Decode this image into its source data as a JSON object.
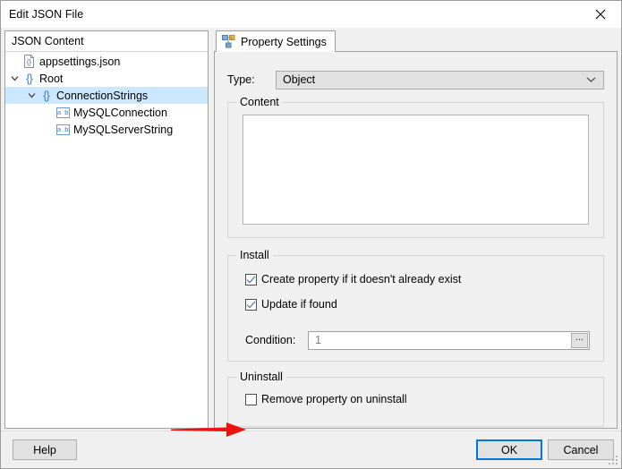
{
  "window": {
    "title": "Edit JSON File",
    "close_icon": "close-icon"
  },
  "tree": {
    "header": "JSON Content",
    "items": [
      {
        "label": "appsettings.json",
        "icon": "json-file-icon",
        "depth": 0,
        "chevron": "none",
        "selected": false
      },
      {
        "label": "Root",
        "icon": "json-object-icon",
        "depth": 0,
        "chevron": "expanded",
        "selected": false
      },
      {
        "label": "ConnectionStrings",
        "icon": "json-object-icon",
        "depth": 1,
        "chevron": "expanded",
        "selected": true
      },
      {
        "label": "MySQLConnection",
        "icon": "json-string-icon",
        "depth": 2,
        "chevron": "none",
        "selected": false
      },
      {
        "label": "MySQLServerString",
        "icon": "json-string-icon",
        "depth": 2,
        "chevron": "none",
        "selected": false
      }
    ],
    "object_glyph": "{}",
    "string_glyph": "a b"
  },
  "tab": {
    "label": "Property Settings",
    "icon": "hierarchy-icon"
  },
  "type": {
    "label": "Type:",
    "value": "Object",
    "dropdown_icon": "chevron-down-icon"
  },
  "content_group": {
    "title": "Content",
    "value": "",
    "placeholder": ""
  },
  "install_group": {
    "title": "Install",
    "create_checkbox": {
      "label": "Create property if it doesn't already exist",
      "checked": true
    },
    "update_checkbox": {
      "label": "Update if found",
      "checked": true
    },
    "condition": {
      "label": "Condition:",
      "value": "1",
      "browse_label": "..."
    }
  },
  "uninstall_group": {
    "title": "Uninstall",
    "remove_checkbox": {
      "label": "Remove property on uninstall",
      "checked": false
    }
  },
  "buttons": {
    "help": "Help",
    "ok": "OK",
    "cancel": "Cancel"
  },
  "annotation": {
    "arrow_color": "#ee1111",
    "points_to": "Remove property on uninstall"
  },
  "colors": {
    "selection": "#cce8ff",
    "accent": "#0078d7",
    "tree_icon_blue": "#3a7bd5"
  }
}
